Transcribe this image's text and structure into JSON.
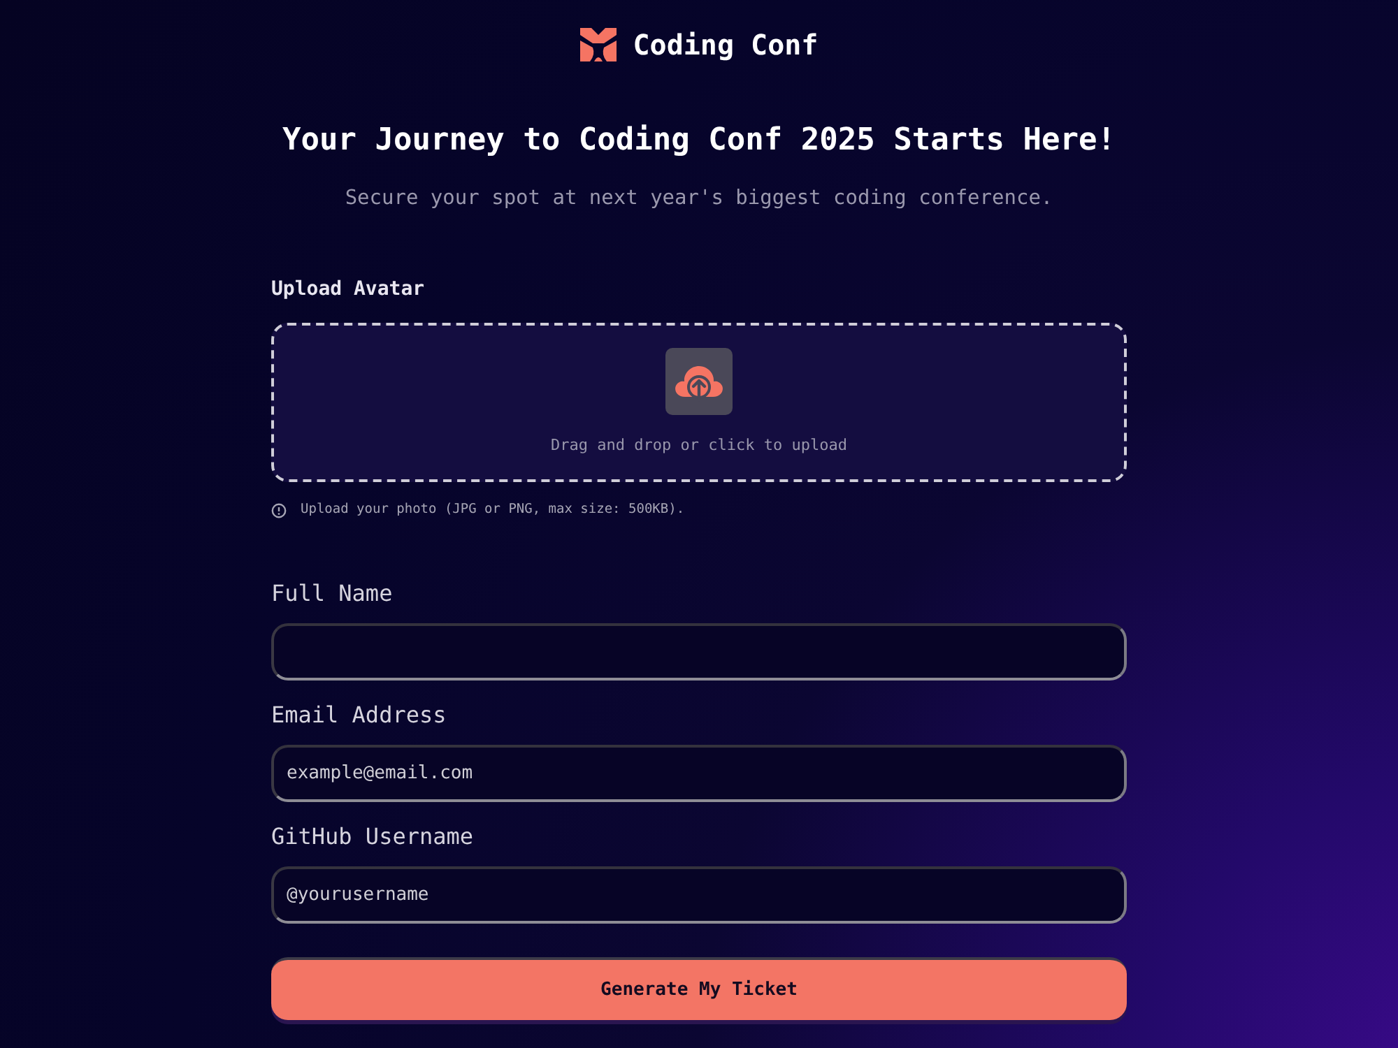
{
  "header": {
    "logo_text": "Coding Conf"
  },
  "hero": {
    "title": "Your Journey to Coding Conf 2025 Starts Here!",
    "subtitle": "Secure your spot at next year's biggest coding conference."
  },
  "upload": {
    "label": "Upload Avatar",
    "dropzone_text": "Drag and drop or click to upload",
    "hint": "Upload your photo (JPG or PNG, max size: 500KB)."
  },
  "fields": [
    {
      "label": "Full Name"
    },
    {
      "label": "Email Address",
      "placeholder": "example@email.com"
    },
    {
      "label": "GitHub Username",
      "placeholder": "@yourusername"
    }
  ],
  "submit_button": {
    "label": "Generate My Ticket"
  }
}
